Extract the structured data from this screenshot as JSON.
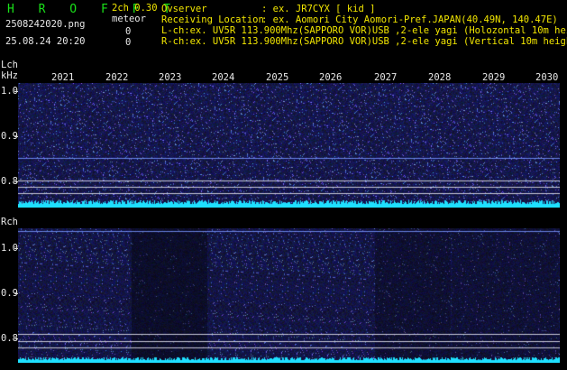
{
  "header": {
    "title": "H R O F F T",
    "filename": "2508242020.png",
    "datetime": "25.08.24 20:20",
    "channel_label": "2ch 0.30",
    "meteor_label": "meteor",
    "count_l": "0",
    "count_r": "0",
    "observer_label": "Ovserver",
    "observer_value": ": ex. JR7CYX [ kid ]",
    "location_label": "Receiving Location",
    "location_value": ": ex. Aomori City Aomori-Pref.JAPAN(40.49N, 140.47E)",
    "lch_info": "L-ch:ex. UV5R 113.900Mhz(SAPPORO VOR)USB ,2-ele yagi (Holozontal 10m height)",
    "rch_info": "R-ch:ex. UV5R 113.900Mhz(SAPPORO VOR)USB ,2-ele yagi (Vertical 10m height)"
  },
  "axis": {
    "lch_label": "Lch",
    "unit": "kHz",
    "rch_label": "Rch",
    "years": [
      "2021",
      "2022",
      "2023",
      "2024",
      "2025",
      "2026",
      "2027",
      "2028",
      "2029",
      "2030"
    ],
    "lch_freq_labels": [
      "1.0",
      "0.9",
      "0.8"
    ],
    "rch_freq_labels": [
      "1.0",
      "0.9",
      "0.8"
    ]
  },
  "colors": {
    "title": "#19e019",
    "highlight": "#f2e600",
    "text": "#e8e8e8",
    "noise_floor": "#1ee0ff",
    "background": "#000000"
  }
}
